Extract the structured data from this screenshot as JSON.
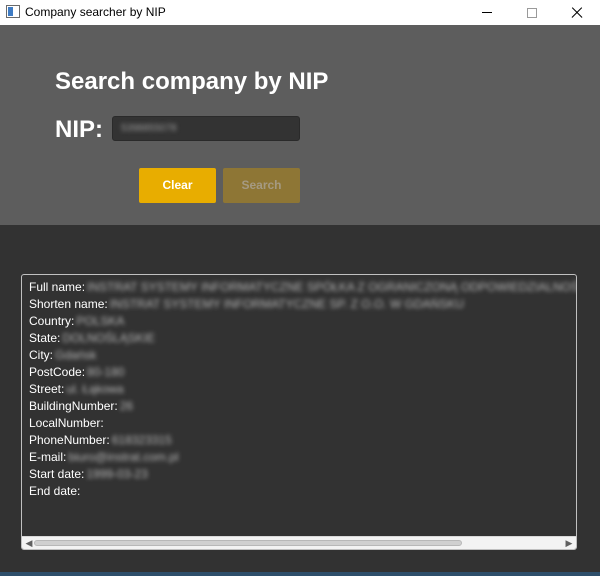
{
  "window": {
    "title": "Company searcher by NIP",
    "app_icon": "java-window-icon",
    "minimize_icon": "minimize-icon",
    "maximize_icon": "maximize-icon",
    "close_icon": "close-icon"
  },
  "form": {
    "heading": "Search company by NIP",
    "nip_label": "NIP:",
    "nip_value": "5398855078",
    "clear_label": "Clear",
    "search_label": "Search"
  },
  "results": {
    "rows": [
      {
        "label": "Full name:",
        "value": "INSTRAT SYSTEMY INFORMATYCZNE SPÓŁKA Z OGRANICZONĄ ODPOWIEDZIALNOŚCIĄ"
      },
      {
        "label": "Shorten name:",
        "value": "INSTRAT SYSTEMY INFORMATYCZNE SP. Z O.O. W GDAŃSKU"
      },
      {
        "label": "Country:",
        "value": "POLSKA"
      },
      {
        "label": "State:",
        "value": "DOLNOŚLĄSKIE"
      },
      {
        "label": "City:",
        "value": "Gdańsk"
      },
      {
        "label": "PostCode:",
        "value": "80-180"
      },
      {
        "label": "Street:",
        "value": "ul. Łąkowa"
      },
      {
        "label": "BuildingNumber:",
        "value": "26"
      },
      {
        "label": "LocalNumber:",
        "value": ""
      },
      {
        "label": "PhoneNumber:",
        "value": "618323315"
      },
      {
        "label": "E-mail:",
        "value": "biuro@instrat.com.pl"
      },
      {
        "label": "Start date:",
        "value": "1999-03-23"
      },
      {
        "label": "End date:",
        "value": ""
      }
    ]
  }
}
